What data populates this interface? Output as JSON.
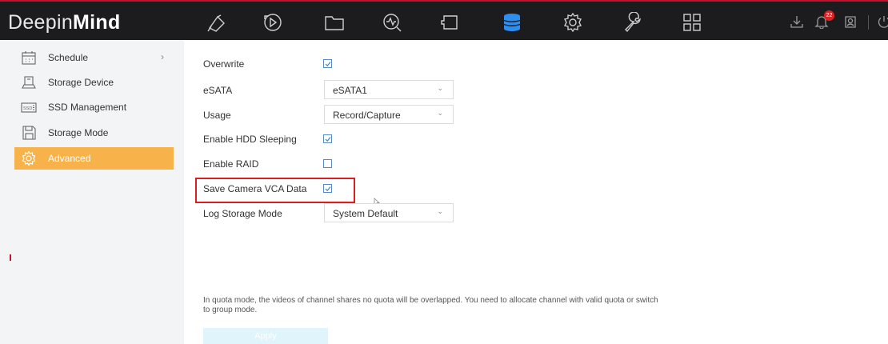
{
  "app": {
    "brand_light": "Deepin",
    "brand_bold": "Mind",
    "accent_color": "#f7b24a",
    "nav_icons": [
      "live-view-icon",
      "playback-icon",
      "file-management-icon",
      "smart-analysis-icon",
      "configuration-icon",
      "storage-icon",
      "system-icon",
      "maintenance-icon",
      "apps-grid-icon"
    ],
    "active_nav": "storage-icon",
    "notification_count": "22"
  },
  "sidebar": {
    "items": [
      {
        "label": "Schedule",
        "icon": "calendar-icon",
        "has_chevron": true,
        "chevron": "›"
      },
      {
        "label": "Storage Device",
        "icon": "hdd-icon"
      },
      {
        "label": "SSD Management",
        "icon": "ssd-icon"
      },
      {
        "label": "Storage Mode",
        "icon": "save-icon"
      },
      {
        "label": "Advanced",
        "icon": "gear-icon",
        "active": true
      }
    ]
  },
  "form": {
    "overwrite": {
      "label": "Overwrite",
      "checked": true
    },
    "esata": {
      "label": "eSATA",
      "value": "eSATA1"
    },
    "usage": {
      "label": "Usage",
      "value": "Record/Capture"
    },
    "hdd_sleeping": {
      "label": "Enable HDD Sleeping",
      "checked": true
    },
    "raid": {
      "label": "Enable RAID",
      "checked": false
    },
    "vca_data": {
      "label": "Save Camera VCA Data",
      "checked": true
    },
    "log_storage": {
      "label": "Log Storage Mode",
      "value": "System Default"
    },
    "caret": "⌄"
  },
  "info_text": "In quota mode, the videos of channel shares no quota will be overlapped. You need to allocate channel with valid quota or switch to group mode.",
  "apply_label": "Apply"
}
